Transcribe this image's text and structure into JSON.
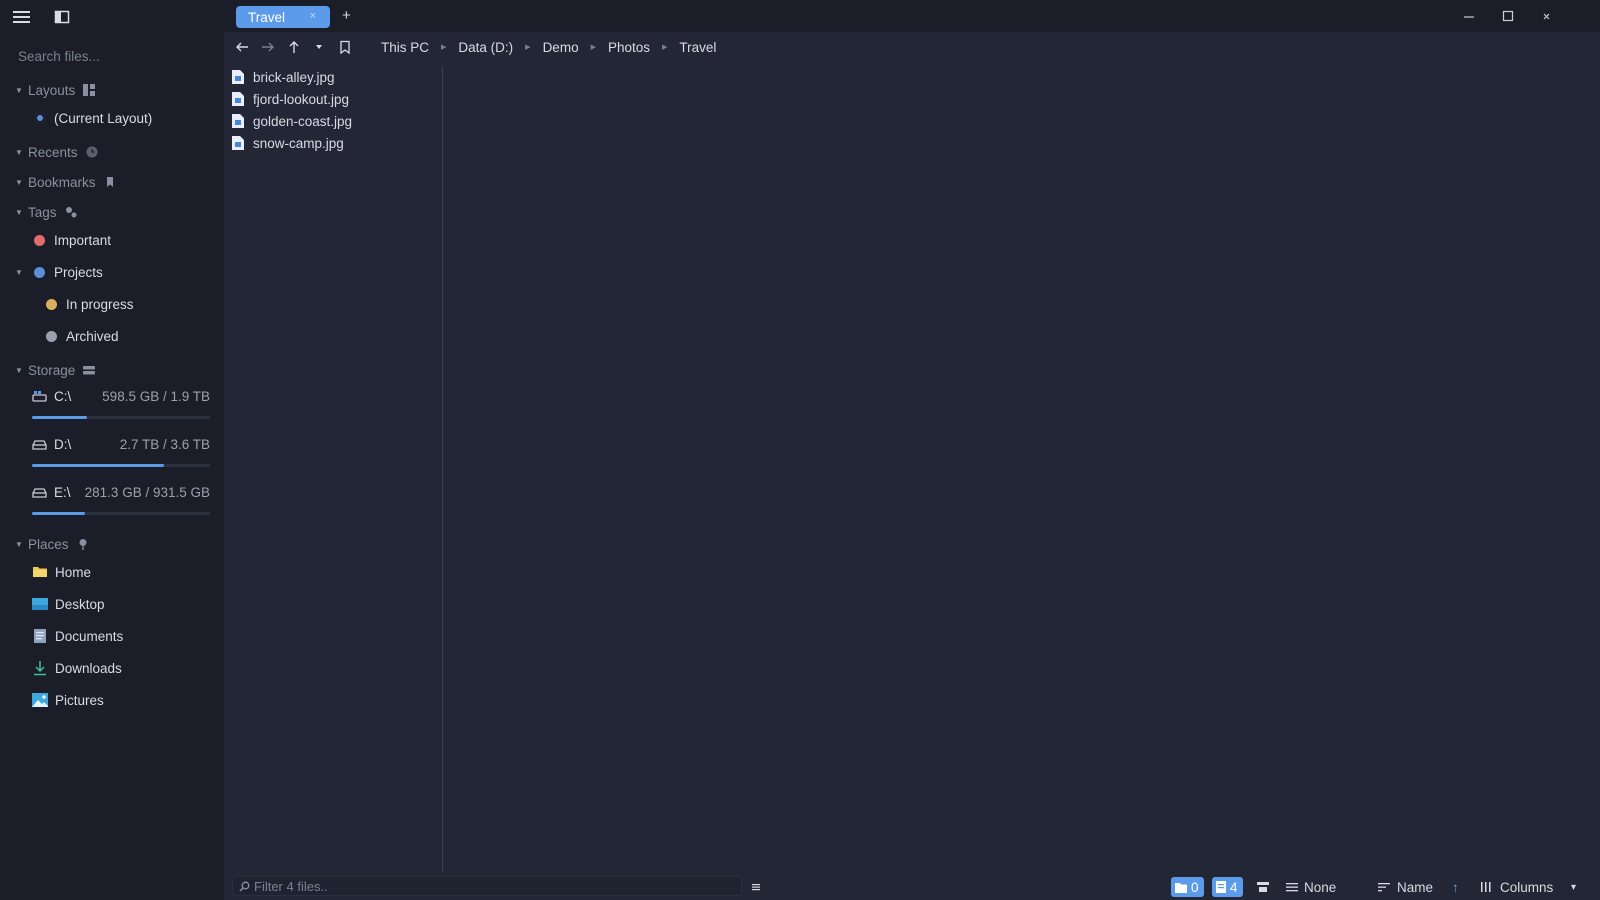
{
  "tab": {
    "label": "Travel",
    "close": "×",
    "add": "+"
  },
  "sidebar": {
    "search_placeholder": "Search files...",
    "layouts": {
      "label": "Layouts",
      "items": [
        "(Current Layout)"
      ]
    },
    "recents": {
      "label": "Recents"
    },
    "bookmarks": {
      "label": "Bookmarks"
    },
    "tags": {
      "label": "Tags",
      "items": [
        {
          "label": "Important",
          "color": "#e06c6c"
        },
        {
          "label": "Projects",
          "color": "#5b8fd6"
        },
        {
          "label": "In progress",
          "color": "#d6b05b"
        },
        {
          "label": "Archived",
          "color": "#9aa0ae"
        }
      ]
    },
    "storage": {
      "label": "Storage",
      "drives": [
        {
          "name": "C:\\",
          "size": "598.5 GB / 1.9 TB",
          "usage": 0.31
        },
        {
          "name": "D:\\",
          "size": "2.7 TB / 3.6 TB",
          "usage": 0.74
        },
        {
          "name": "E:\\",
          "size": "281.3 GB / 931.5 GB",
          "usage": 0.3
        }
      ]
    },
    "places": {
      "label": "Places",
      "items": [
        {
          "label": "Home",
          "icon": "folder-icon"
        },
        {
          "label": "Desktop",
          "icon": "desktop-icon"
        },
        {
          "label": "Documents",
          "icon": "documents-icon"
        },
        {
          "label": "Downloads",
          "icon": "download-icon"
        },
        {
          "label": "Pictures",
          "icon": "pictures-icon"
        }
      ]
    }
  },
  "breadcrumb": [
    "This PC",
    "Data (D:)",
    "Demo",
    "Photos",
    "Travel"
  ],
  "files": [
    "brick-alley.jpg",
    "fjord-lookout.jpg",
    "golden-coast.jpg",
    "snow-camp.jpg"
  ],
  "statusbar": {
    "filter_placeholder": "Filter 4 files..",
    "folder_count": "0",
    "file_count": "4",
    "group_by": "None",
    "sort_by": "Name",
    "sort_direction": "↑",
    "view_mode": "Columns",
    "view_dropdown": "▾"
  },
  "colors": {
    "accent": "#5c9bea",
    "panel": "#232735",
    "sidebar": "#1b1e28"
  }
}
